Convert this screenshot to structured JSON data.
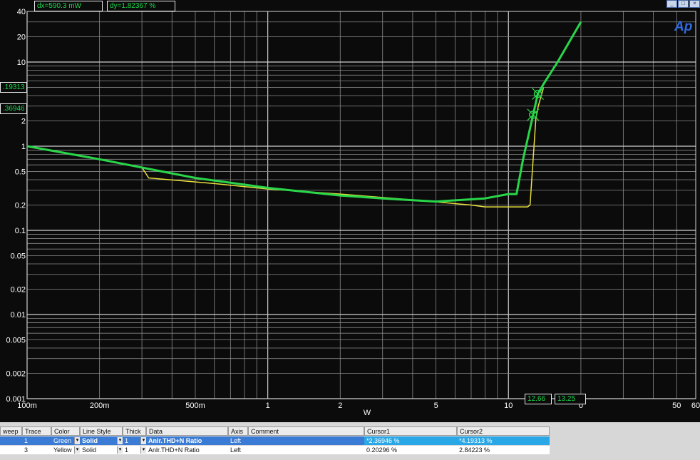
{
  "window": {
    "buttons": [
      "_",
      "□",
      "×"
    ]
  },
  "logo": "Ap",
  "readouts": {
    "dx": "dx=590.3  mW",
    "dy": "dy=1.82367  %"
  },
  "y_cursor_labels": [
    ".19313",
    ".36946"
  ],
  "x_cursor_labels": [
    "12.66",
    "13.25"
  ],
  "chart_data": {
    "type": "line",
    "xlabel": "W",
    "ylabel": "",
    "x_scale": "log",
    "y_scale": "log",
    "xlim": [
      0.1,
      60
    ],
    "ylim": [
      0.001,
      40
    ],
    "grid": true,
    "x_ticks": [
      {
        "value": 0.1,
        "label": "100m"
      },
      {
        "value": 0.2,
        "label": "200m"
      },
      {
        "value": 0.5,
        "label": "500m"
      },
      {
        "value": 1,
        "label": "1"
      },
      {
        "value": 2,
        "label": "2"
      },
      {
        "value": 5,
        "label": "5"
      },
      {
        "value": 10,
        "label": "10"
      },
      {
        "value": 20,
        "label": "0"
      },
      {
        "value": 50,
        "label": "50"
      },
      {
        "value": 60,
        "label": "60"
      }
    ],
    "y_ticks": [
      {
        "value": 40,
        "label": "40"
      },
      {
        "value": 20,
        "label": "20"
      },
      {
        "value": 10,
        "label": "10"
      },
      {
        "value": 2,
        "label": "2"
      },
      {
        "value": 1,
        "label": "1"
      },
      {
        "value": 0.5,
        "label": "0.5"
      },
      {
        "value": 0.2,
        "label": "0.2"
      },
      {
        "value": 0.1,
        "label": "0.1"
      },
      {
        "value": 0.05,
        "label": "0.05"
      },
      {
        "value": 0.02,
        "label": "0.02"
      },
      {
        "value": 0.01,
        "label": "0.01"
      },
      {
        "value": 0.005,
        "label": "0.005"
      },
      {
        "value": 0.002,
        "label": "0.002"
      },
      {
        "value": 0.001,
        "label": "0.001"
      }
    ],
    "series": [
      {
        "color": "#29d64a",
        "x": [
          0.1,
          0.2,
          0.5,
          1,
          2,
          3,
          5,
          8,
          10,
          10.8,
          11.5,
          12.66,
          13.25,
          14,
          16,
          20
        ],
        "y": [
          1.0,
          0.7,
          0.42,
          0.32,
          0.26,
          0.24,
          0.22,
          0.24,
          0.27,
          0.27,
          0.7,
          2.37,
          4.19,
          5.5,
          10,
          30
        ]
      },
      {
        "color": "#e8e03a",
        "x": [
          0.1,
          0.3,
          0.32,
          0.6,
          1,
          2,
          4,
          7,
          8,
          11,
          12,
          12.3,
          13,
          13.3,
          14
        ],
        "y": [
          1.0,
          0.56,
          0.42,
          0.36,
          0.31,
          0.27,
          0.23,
          0.2,
          0.19,
          0.19,
          0.19,
          0.2,
          2.1,
          3.0,
          5.0
        ]
      }
    ],
    "cursors": [
      {
        "x": 12.66,
        "y": 2.36946
      },
      {
        "x": 13.25,
        "y": 4.19313
      }
    ]
  },
  "table": {
    "headers": {
      "sweep": "weep",
      "trace": "Trace",
      "color": "Color",
      "line_style": "Line Style",
      "thick": "Thick",
      "data": "Data",
      "axis": "Axis",
      "comment": "Comment",
      "cursor1": "Cursor1",
      "cursor2": "Cursor2"
    },
    "rows": [
      {
        "trace": "1",
        "color": "Green",
        "style": "Solid",
        "thick": "1",
        "data": "Anlr.THD+N Ratio",
        "axis": "Left",
        "comment": "",
        "cursor1": "*2.36946  %",
        "cursor2": "*4.19313  %"
      },
      {
        "trace": "3",
        "color": "Yellow",
        "style": "Solid",
        "thick": "1",
        "data": "Anlr.THD+N Ratio",
        "axis": "Left",
        "comment": "",
        "cursor1": "0.20296  %",
        "cursor2": "2.84223  %"
      }
    ]
  }
}
